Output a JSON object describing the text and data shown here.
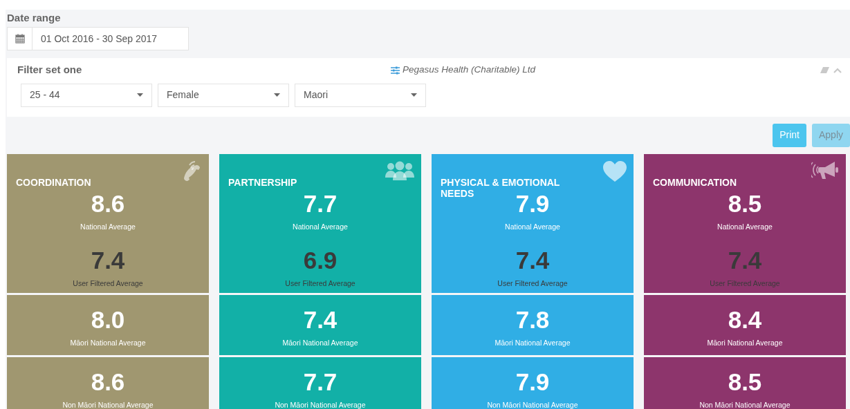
{
  "date_range": {
    "label": "Date range",
    "value": "01 Oct 2016 - 30 Sep 2017"
  },
  "filter_set": {
    "title": "Filter set one",
    "organisation": "Pegasus Health (Charitable) Ltd",
    "selects": [
      {
        "value": "25 - 44"
      },
      {
        "value": "Female"
      },
      {
        "value": "Maori"
      }
    ]
  },
  "buttons": [
    {
      "label": "Print",
      "disabled": false
    },
    {
      "label": "Apply",
      "disabled": true
    }
  ],
  "cards": [
    {
      "title": "COORDINATION",
      "color": "#a09770",
      "panels": [
        [
          {
            "value": "8.6",
            "label": "National Average",
            "kind": "national"
          },
          {
            "value": "7.4",
            "label": "User Filtered Average",
            "kind": "filtered"
          }
        ],
        [
          {
            "value": "8.0",
            "label": "Māori National Average",
            "kind": "national"
          }
        ],
        [
          {
            "value": "8.6",
            "label": "Non Māori National Average",
            "kind": "national"
          }
        ]
      ]
    },
    {
      "title": "PARTNERSHIP",
      "color": "#12b0a7",
      "panels": [
        [
          {
            "value": "7.7",
            "label": "National Average",
            "kind": "national"
          },
          {
            "value": "6.9",
            "label": "User Filtered Average",
            "kind": "filtered"
          }
        ],
        [
          {
            "value": "7.4",
            "label": "Māori National Average",
            "kind": "national"
          }
        ],
        [
          {
            "value": "7.7",
            "label": "Non Māori National Average",
            "kind": "national"
          }
        ]
      ]
    },
    {
      "title": "PHYSICAL & EMOTIONAL NEEDS",
      "color": "#30aee5",
      "panels": [
        [
          {
            "value": "7.9",
            "label": "National Average",
            "kind": "national"
          },
          {
            "value": "7.4",
            "label": "User Filtered Average",
            "kind": "filtered"
          }
        ],
        [
          {
            "value": "7.8",
            "label": "Māori National Average",
            "kind": "national"
          }
        ],
        [
          {
            "value": "7.9",
            "label": "Non Māori National Average",
            "kind": "national"
          }
        ]
      ]
    },
    {
      "title": "COMMUNICATION",
      "color": "#8d356c",
      "panels": [
        [
          {
            "value": "8.5",
            "label": "National Average",
            "kind": "national"
          },
          {
            "value": "7.4",
            "label": "User Filtered Average",
            "kind": "filtered"
          }
        ],
        [
          {
            "value": "8.4",
            "label": "Māori National Average",
            "kind": "national"
          }
        ],
        [
          {
            "value": "8.5",
            "label": "Non Māori National Average",
            "kind": "national"
          }
        ]
      ]
    }
  ]
}
